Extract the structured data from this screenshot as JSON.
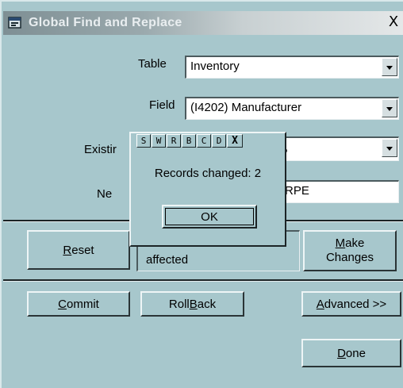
{
  "window": {
    "title": "Global Find and Replace",
    "close_glyph": "X",
    "icon": "app-window-icon"
  },
  "form": {
    "table_label": "Table",
    "table_value": "Inventory",
    "field_label": "Field",
    "field_value": "(I4202)  Manufacturer",
    "existing_label": "Existir",
    "existing_value": ",",
    "new_label": "Ne",
    "new_value": "RPE"
  },
  "buttons": {
    "reset": {
      "accel": "R",
      "rest": "eset"
    },
    "affected_text": "affected",
    "make_changes_line1_accel": "M",
    "make_changes_line1_rest": "ake",
    "make_changes_line2": "Changes",
    "commit": {
      "accel": "C",
      "rest": "ommit"
    },
    "rollback": {
      "pre": "Roll",
      "accel": "B",
      "rest": "ack"
    },
    "advanced": {
      "accel": "A",
      "rest": "dvanced >>"
    },
    "done": {
      "accel": "D",
      "rest": "one"
    }
  },
  "popup": {
    "toolbar": [
      "S",
      "W",
      "R",
      "B",
      "C",
      "D",
      "X"
    ],
    "message": "Records changed: 2",
    "ok_label": "OK"
  },
  "colors": {
    "window_bg": "#a7c7cc",
    "title_gradient_start": "#7e8f94",
    "title_gradient_end": "#e4e7e8"
  }
}
